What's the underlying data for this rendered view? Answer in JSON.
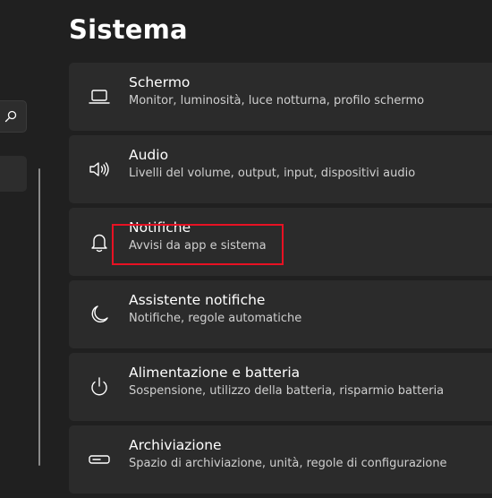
{
  "page": {
    "title": "Sistema"
  },
  "sidebar": {
    "search_icon": "search-icon"
  },
  "settings": [
    {
      "icon": "monitor-icon",
      "title": "Schermo",
      "subtitle": "Monitor, luminosità, luce notturna, profilo schermo"
    },
    {
      "icon": "speaker-icon",
      "title": "Audio",
      "subtitle": "Livelli del volume, output, input, dispositivi audio"
    },
    {
      "icon": "bell-icon",
      "title": "Notifiche",
      "subtitle": "Avvisi da app e sistema"
    },
    {
      "icon": "moon-icon",
      "title": "Assistente notifiche",
      "subtitle": "Notifiche, regole automatiche"
    },
    {
      "icon": "power-icon",
      "title": "Alimentazione e batteria",
      "subtitle": "Sospensione, utilizzo della batteria, risparmio batteria"
    },
    {
      "icon": "storage-icon",
      "title": "Archiviazione",
      "subtitle": "Spazio di archiviazione, unità, regole di configurazione"
    }
  ],
  "colors": {
    "background": "#202020",
    "card": "#2b2b2b",
    "highlight": "#e81123"
  }
}
